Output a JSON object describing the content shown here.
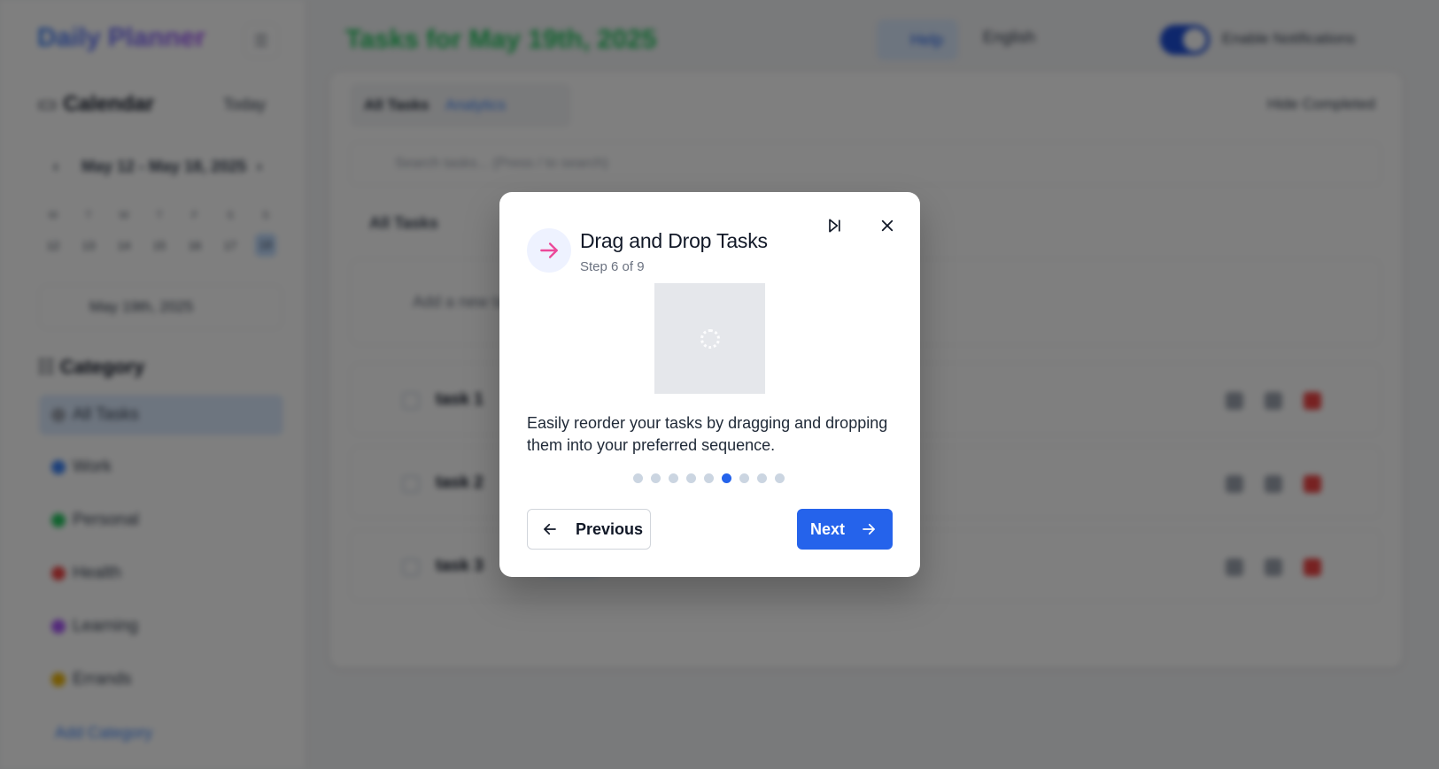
{
  "background": {
    "sidebar": {
      "app_title": "Daily Planner",
      "calendar_title": "Calendar",
      "today_label": "Today",
      "week_range": "May 12 - May 18, 2025",
      "weekdays": [
        "M",
        "T",
        "W",
        "T",
        "F",
        "S",
        "S"
      ],
      "dates": [
        "12",
        "13",
        "14",
        "15",
        "16",
        "17",
        "18"
      ],
      "selected_date": "May 19th, 2025",
      "category_title": "Category",
      "categories": [
        {
          "label": "All Tasks",
          "color": ""
        },
        {
          "label": "Work",
          "color": "#3b82f6"
        },
        {
          "label": "Personal",
          "color": "#22c55e"
        },
        {
          "label": "Health",
          "color": "#ef4444"
        },
        {
          "label": "Learning",
          "color": "#a855f7"
        },
        {
          "label": "Errands",
          "color": "#eab308"
        }
      ],
      "add_category_label": "Add Category"
    },
    "header": {
      "title": "Tasks for May 19th, 2025",
      "help_label": "Help",
      "language_label": "English",
      "notifications_label": "Enable Notifications"
    },
    "main": {
      "tabs": [
        "All Tasks",
        "Analytics"
      ],
      "hide_completed_label": "Hide Completed",
      "search_placeholder": "Search tasks... (Press / to search)",
      "filter_label": "All Tasks",
      "add_task_placeholder": "Add a new task",
      "tasks": [
        {
          "name": "task 1"
        },
        {
          "name": "task 2"
        },
        {
          "name": "task 3"
        }
      ]
    }
  },
  "tour": {
    "title": "Drag and Drop Tasks",
    "step_text": "Step 6 of 9",
    "current_step": 6,
    "total_steps": 9,
    "description": "Easily reorder your tasks by dragging and dropping them into your preferred sequence.",
    "previous_label": "Previous",
    "next_label": "Next",
    "icons": {
      "step": "arrow-right-icon",
      "skip": "skip-forward-icon",
      "close": "close-icon"
    },
    "colors": {
      "accent": "#2563eb",
      "step_icon": "#ec4899",
      "inactive_dot": "#cbd5e1"
    }
  }
}
